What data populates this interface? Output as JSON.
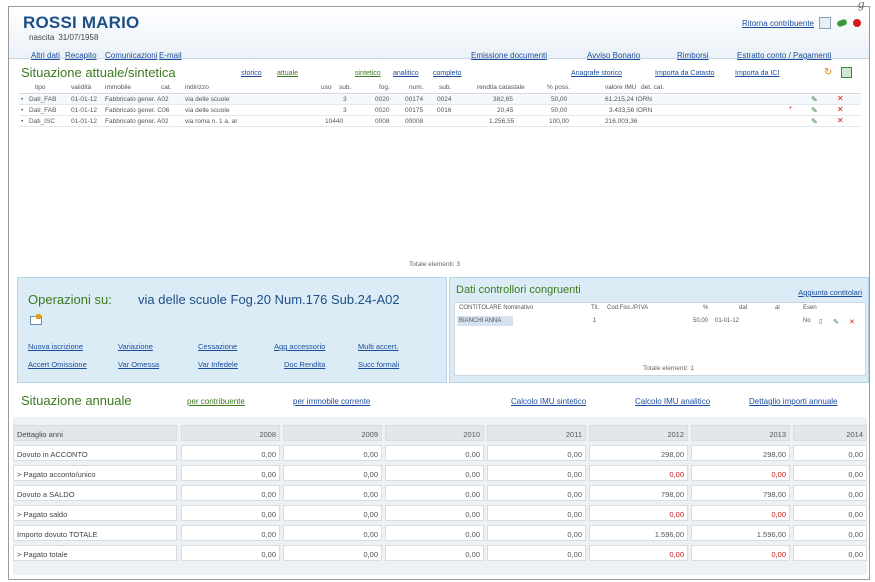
{
  "corner_mark": "g",
  "header": {
    "name": "ROSSI MARIO",
    "born_label": "nascita",
    "born_date": "31/07/1958",
    "links_left": [
      "Altri dati",
      "Recapito",
      "Comunicazioni",
      "E-mail"
    ],
    "links_right": [
      "Emissione documenti",
      "Avviso Bonario",
      "Rimborsi",
      "Estratto conto / Pagamenti"
    ],
    "history_link": "Ritorna contribuente",
    "icons": [
      "document-icon",
      "refresh-icon",
      "close-dot-icon"
    ]
  },
  "situazione": {
    "title": "Situazione attuale/sintetica",
    "tabs": [
      "storico",
      "attuale",
      "sintetico",
      "analitico",
      "completo"
    ],
    "right_links": [
      "Anagrafe storico",
      "Importa da Catasto",
      "Importa da ICI"
    ],
    "columns": [
      "tipo",
      "validità",
      "immobile",
      "cat.",
      "indirizzo",
      "uso",
      "sub.",
      "fog.",
      "num.",
      "sub.",
      "rendita catastale",
      "% poss.",
      "valore IMU",
      "det. cat."
    ],
    "rows": [
      [
        "Dati_FAB",
        "01-01-12",
        "Fabbricato gener. A02",
        "via delle scuole",
        "3",
        "0020",
        "00174",
        "0024",
        "382,65",
        "50,00",
        "61.215,24 IORN"
      ],
      [
        "Dati_FAB",
        "01-01-12",
        "Fabbricato gener. C06",
        "via delle scuole",
        "3",
        "0020",
        "00175",
        "0016",
        "20,45",
        "50,00",
        "3.433,56 IORN"
      ],
      [
        "Dati_ISC",
        "01-01-12",
        "Fabbricato gener. A02",
        "via roma n. 1 a, ar",
        "10440",
        "0008",
        "00008",
        "",
        "1.256,55",
        "100,00",
        "216.003,36"
      ]
    ],
    "total": "Totale elementi: 3"
  },
  "operazioni": {
    "title": "Operazioni su:",
    "subject": "via delle scuole Fog.20 Num.176 Sub.24-A02",
    "links_row1": [
      "Nuova iscrizione",
      "Variazione",
      "Cessazione",
      "Agg accessorio",
      "Multi accert."
    ],
    "links_row2": [
      "Accert Omissione",
      "Var Omessa",
      "Var Infedele",
      "Doc Rendita",
      "Succ formali"
    ]
  },
  "controllori": {
    "title": "Dati controllori congruenti",
    "add_link": "Aggiunta contitolari",
    "columns": [
      "CONTITOLARE Nominativo",
      "Tit.",
      "Cod.Fisc./P.IVA",
      "%",
      "dal",
      "al",
      "Esen"
    ],
    "row": [
      "BIANCHI ANNA",
      "",
      "1",
      "50,00",
      "01-01-12",
      "",
      "No"
    ],
    "total": "Totale elementi: 1"
  },
  "annuale": {
    "title": "Situazione annuale",
    "links": [
      "per contribuente",
      "per immobile corrente",
      "Calcolo IMU sintetico",
      "Calcolo IMU analitico",
      "Dettaglio importi annuale"
    ],
    "header_label": "Dettaglio anni",
    "years": [
      "2008",
      "2009",
      "2010",
      "2011",
      "2012",
      "2013",
      "2014"
    ],
    "rows": [
      {
        "label": "Dovuto in ACCONTO",
        "values": [
          "0,00",
          "0,00",
          "0,00",
          "0,00",
          "298,00",
          "298,00",
          "0,00"
        ],
        "red": false
      },
      {
        "label": "> Pagato acconto/unico",
        "values": [
          "0,00",
          "0,00",
          "0,00",
          "0,00",
          "0,00",
          "0,00",
          "0,00"
        ],
        "red": true
      },
      {
        "label": "Dovuto a SALDO",
        "values": [
          "0,00",
          "0,00",
          "0,00",
          "0,00",
          "798,00",
          "798,00",
          "0,00"
        ],
        "red": false
      },
      {
        "label": "> Pagato saldo",
        "values": [
          "0,00",
          "0,00",
          "0,00",
          "0,00",
          "0,00",
          "0,00",
          "0,00"
        ],
        "red": true
      },
      {
        "label": "Importo dovuto TOTALE",
        "values": [
          "0,00",
          "0,00",
          "0,00",
          "0,00",
          "1.596,00",
          "1.596,00",
          "0,00"
        ],
        "red": false
      },
      {
        "label": "> Pagato totale",
        "values": [
          "0,00",
          "0,00",
          "0,00",
          "0,00",
          "0,00",
          "0,00",
          "0,00"
        ],
        "red": true
      }
    ]
  }
}
